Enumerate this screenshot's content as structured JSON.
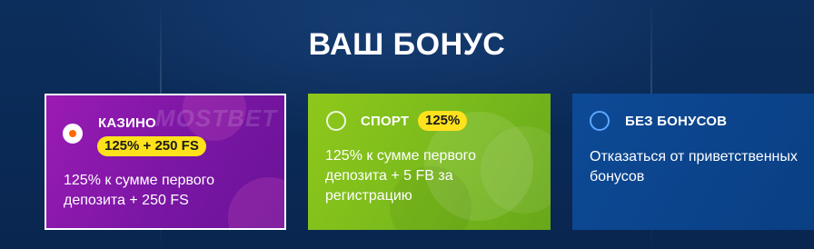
{
  "page": {
    "heading": "ВАШ БОНУС"
  },
  "cards": [
    {
      "id": "casino",
      "title": "КАЗИНО",
      "badge": "125% + 250 FS",
      "description": "125% к сумме первого депозита + 250 FS",
      "watermark": "MOSTBET",
      "selected": true,
      "background": "#8a18ac"
    },
    {
      "id": "sport",
      "title": "СПОРТ",
      "badge": "125%",
      "description": "125% к сумме первого депозита + 5 FB за регистрацию",
      "selected": false,
      "background": "#7fbe1c"
    },
    {
      "id": "none",
      "title": "БЕЗ БОНУСОВ",
      "description": "Отказаться от приветственных бонусов",
      "selected": false,
      "background": "#0b4489"
    }
  ],
  "colors": {
    "page_background": "#0b2a56",
    "badge": "#ffe21c",
    "radio_selected_dot": "#ff6a00",
    "radio_empty_border_blue": "#5da6ff"
  }
}
